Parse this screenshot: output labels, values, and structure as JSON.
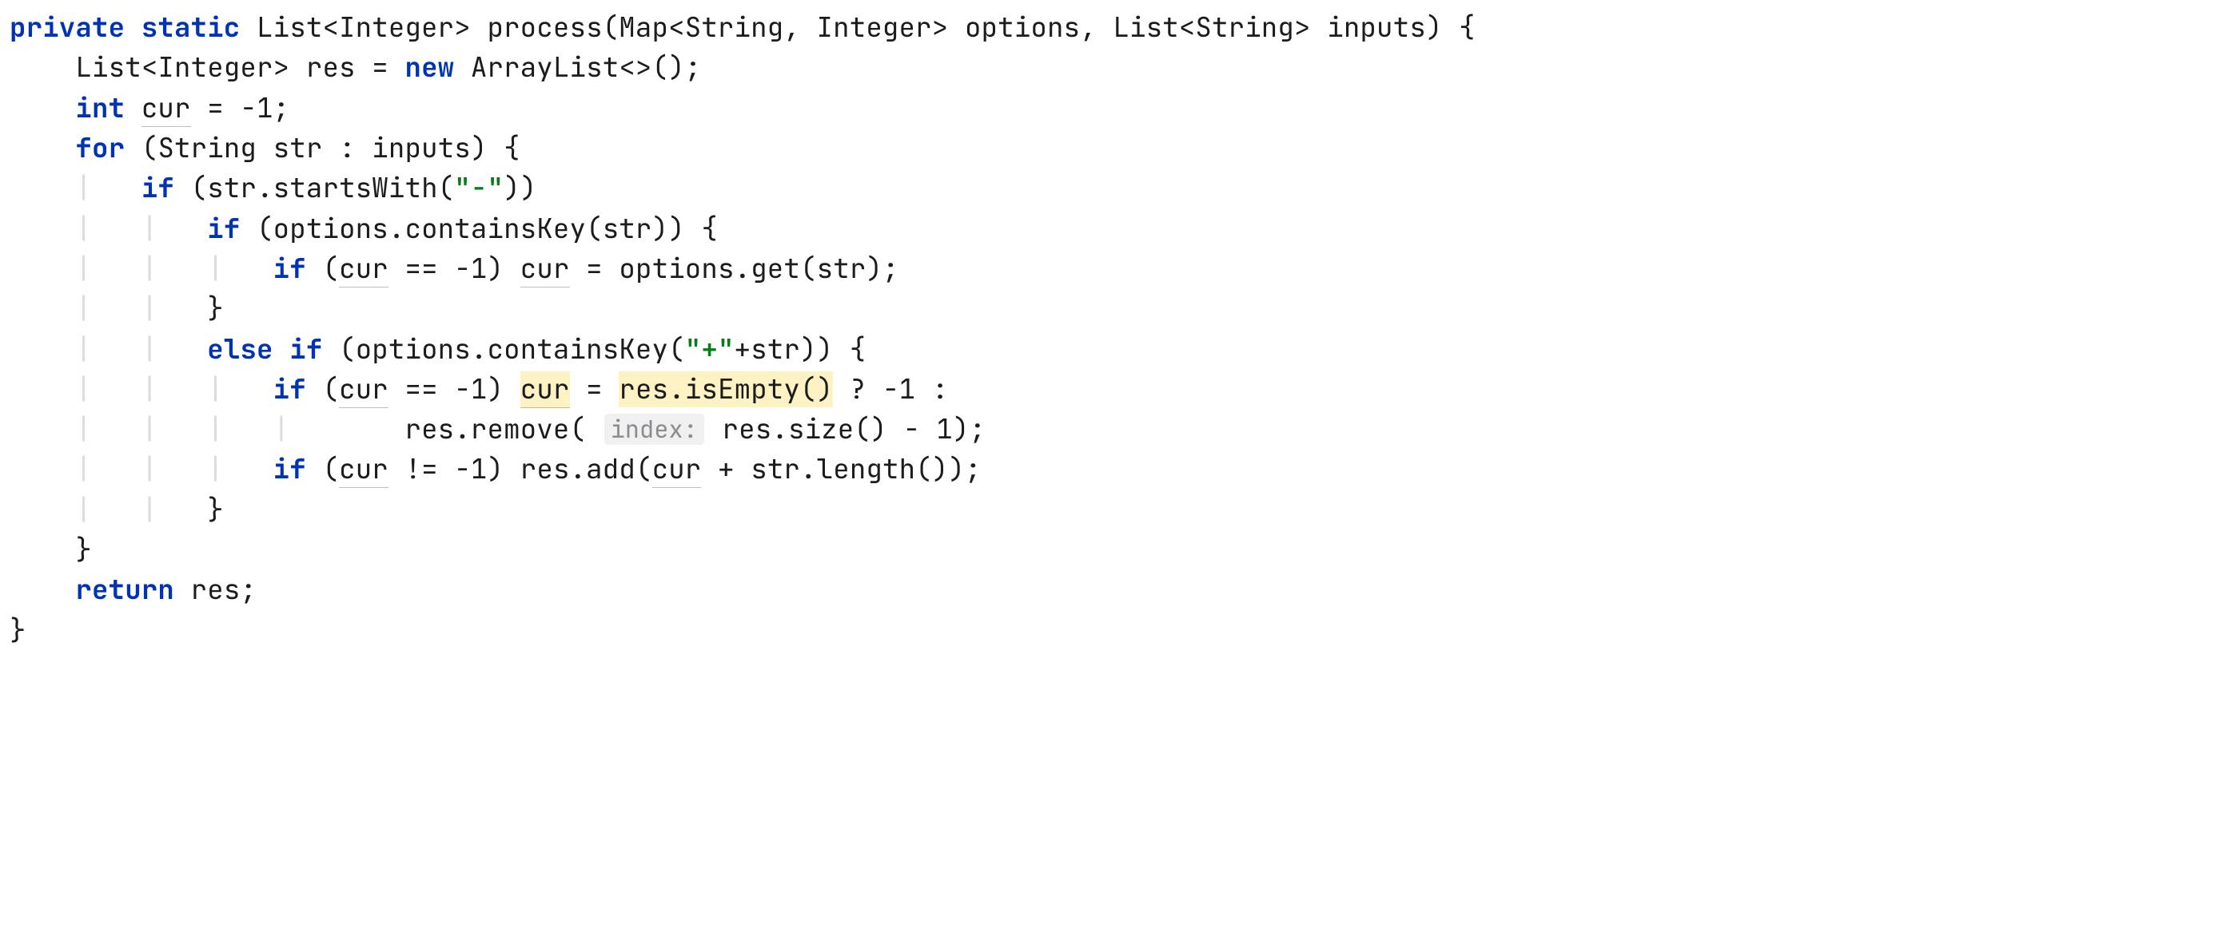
{
  "kw": {
    "private": "private",
    "static": "static",
    "new": "new",
    "int": "int",
    "for": "for",
    "if": "if",
    "else": "else",
    "return": "return"
  },
  "types": {
    "List": "List",
    "Integer": "Integer",
    "Map": "Map",
    "String": "String",
    "ArrayList": "ArrayList"
  },
  "ids": {
    "process": "process",
    "options": "options",
    "inputs": "inputs",
    "res": "res",
    "cur": "cur",
    "str": "str"
  },
  "methods": {
    "startsWith": "startsWith",
    "containsKey": "containsKey",
    "get": "get",
    "isEmpty": "isEmpty",
    "remove": "remove",
    "size": "size",
    "add": "add",
    "length": "length"
  },
  "strings": {
    "dash": "\"-\"",
    "plus": "\"+\""
  },
  "numbers": {
    "neg1": "-1",
    "one": "1"
  },
  "hint": {
    "index": "index:"
  },
  "punct": {
    "lt": "<",
    "gt": ">",
    "comma": ",",
    "lparen": "(",
    "rparen": ")",
    "lbrace": "{",
    "rbrace": "}",
    "semi": ";",
    "diamond": "<>",
    "eq": "=",
    "eqeq": "==",
    "neq": "!=",
    "colon": ":",
    "dot": ".",
    "plusop": "+",
    "minusop": "-",
    "qmark": "?",
    "pipe": "|"
  }
}
